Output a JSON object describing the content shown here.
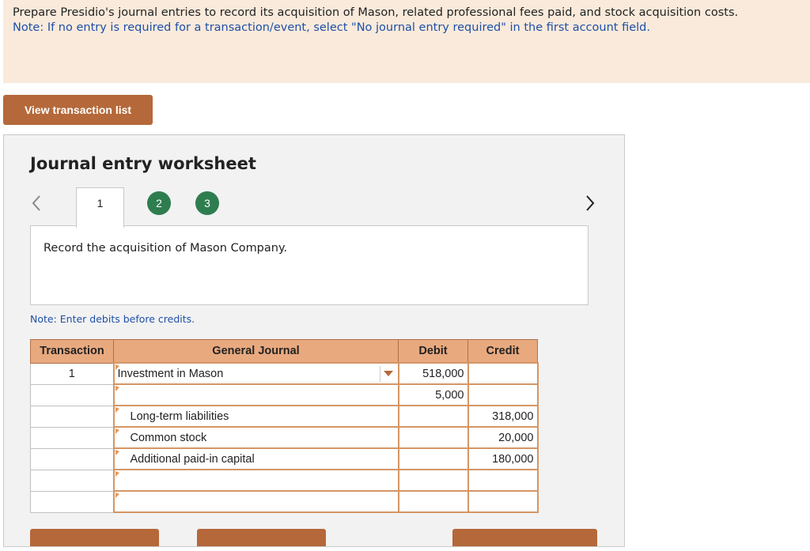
{
  "instructions": {
    "main": "Prepare Presidio's journal entries to record its acquisition of Mason, related professional fees paid, and stock acquisition costs.",
    "note": "Note: If no entry is required for a transaction/event, select \"No journal entry required\" in the first account field."
  },
  "buttons": {
    "view_transaction_list": "View transaction list"
  },
  "worksheet": {
    "title": "Journal entry worksheet",
    "tabs": [
      "1",
      "2",
      "3"
    ],
    "description": "Record the acquisition of Mason Company.",
    "note": "Note: Enter debits before credits."
  },
  "journal": {
    "headers": {
      "transaction": "Transaction",
      "general_journal": "General Journal",
      "debit": "Debit",
      "credit": "Credit"
    },
    "rows": [
      {
        "transaction": "1",
        "account": "Investment in Mason",
        "debit": "518,000",
        "credit": ""
      },
      {
        "transaction": "",
        "account": "",
        "debit": "5,000",
        "credit": ""
      },
      {
        "transaction": "",
        "account": "Long-term liabilities",
        "debit": "",
        "credit": "318,000"
      },
      {
        "transaction": "",
        "account": "Common stock",
        "debit": "",
        "credit": "20,000"
      },
      {
        "transaction": "",
        "account": "Additional paid-in capital",
        "debit": "",
        "credit": "180,000"
      },
      {
        "transaction": "",
        "account": "",
        "debit": "",
        "credit": ""
      },
      {
        "transaction": "",
        "account": "",
        "debit": "",
        "credit": ""
      }
    ]
  },
  "colors": {
    "accent": "#b5683a",
    "header_bg": "#e8a97f",
    "tab_green": "#2e7d4f",
    "note_blue": "#1f4fa8",
    "instructions_bg": "#f9eadb"
  }
}
